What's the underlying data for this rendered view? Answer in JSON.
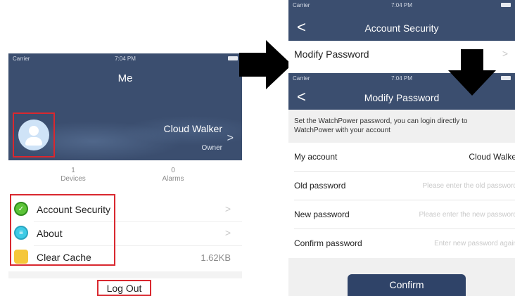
{
  "left_screen": {
    "status": {
      "carrier": "Carrier",
      "time": "7:04 PM"
    },
    "title": "Me",
    "user": {
      "name": "Cloud Walker",
      "role": "Owner"
    },
    "stats": [
      {
        "value": "1",
        "label": "Devices"
      },
      {
        "value": "0",
        "label": "Alarms"
      }
    ],
    "menu": [
      {
        "label": "Account Security",
        "icon": "shield-icon"
      },
      {
        "label": "About",
        "icon": "info-icon"
      },
      {
        "label": "Clear Cache",
        "icon": "folder-icon",
        "value": "1.62KB"
      }
    ],
    "logout_label": "Log Out",
    "chevron": ">"
  },
  "account_security_screen": {
    "status": {
      "carrier": "Carrier",
      "time": "7:04 PM"
    },
    "back": "<",
    "title": "Account Security",
    "rows": [
      {
        "label": "Modify Password"
      }
    ]
  },
  "modify_password_screen": {
    "status": {
      "carrier": "Carrier",
      "time": "7:04 PM"
    },
    "back": "<",
    "title": "Modify Password",
    "info": "Set the WatchPower password, you can login directly to WatchPower with your account",
    "fields": {
      "account": {
        "label": "My account",
        "value": "Cloud Walker"
      },
      "old": {
        "label": "Old password",
        "placeholder": "Please enter the old password"
      },
      "new": {
        "label": "New password",
        "placeholder": "Please enter the new password"
      },
      "confirm": {
        "label": "Confirm password",
        "placeholder": "Enter new password again"
      }
    },
    "confirm_label": "Confirm"
  },
  "colors": {
    "header": "#3b4e6f",
    "button": "#2f4368",
    "highlight": "#d9282f",
    "arrow": "#000000"
  }
}
